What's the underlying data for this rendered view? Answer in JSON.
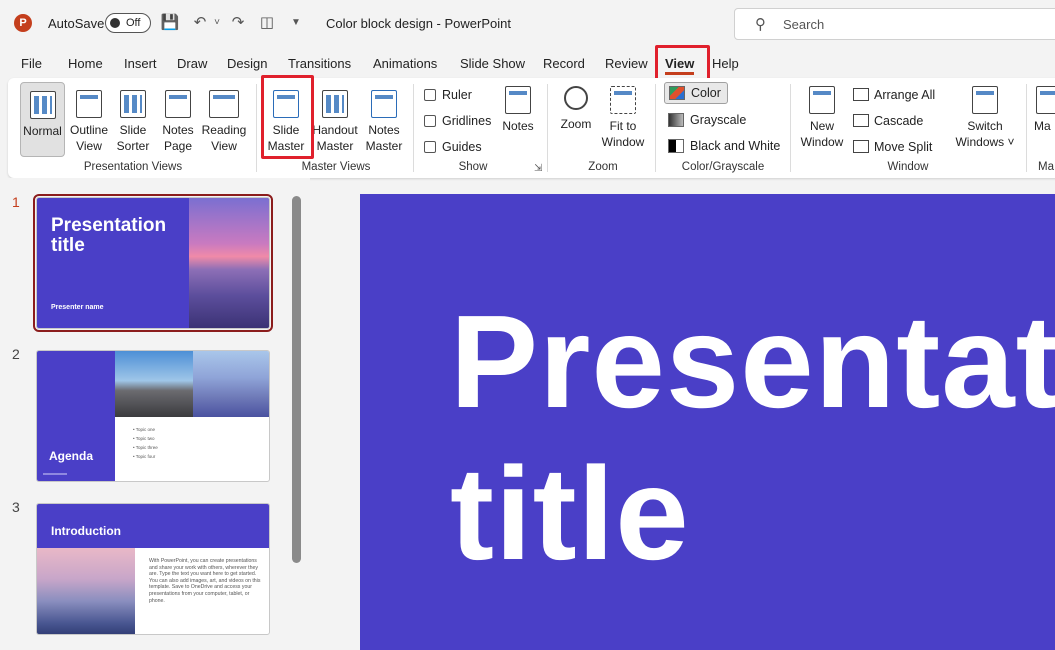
{
  "titlebar": {
    "logo": "P",
    "autosave_label": "AutoSave",
    "toggle_state": "Off",
    "doc_title": "Color block design  -  PowerPoint",
    "search_placeholder": "Search"
  },
  "menu": {
    "tabs": [
      "File",
      "Home",
      "Insert",
      "Draw",
      "Design",
      "Transitions",
      "Animations",
      "Slide Show",
      "Record",
      "Review",
      "View",
      "Help"
    ],
    "active": "View"
  },
  "ribbon": {
    "presentation_views": {
      "label": "Presentation Views",
      "normal": "Normal",
      "outline_1": "Outline",
      "outline_2": "View",
      "sorter_1": "Slide",
      "sorter_2": "Sorter",
      "notes_page_1": "Notes",
      "notes_page_2": "Page",
      "reading_1": "Reading",
      "reading_2": "View"
    },
    "master_views": {
      "label": "Master Views",
      "slide_master_1": "Slide",
      "slide_master_2": "Master",
      "handout_1": "Handout",
      "handout_2": "Master",
      "notes_master_1": "Notes",
      "notes_master_2": "Master"
    },
    "show": {
      "label": "Show",
      "ruler": "Ruler",
      "gridlines": "Gridlines",
      "guides": "Guides",
      "notes": "Notes"
    },
    "zoom": {
      "label": "Zoom",
      "zoom": "Zoom",
      "fit_1": "Fit to",
      "fit_2": "Window"
    },
    "color_grayscale": {
      "label": "Color/Grayscale",
      "color": "Color",
      "grayscale": "Grayscale",
      "bw": "Black and White"
    },
    "window": {
      "label": "Window",
      "new_1": "New",
      "new_2": "Window",
      "arrange_all": "Arrange All",
      "cascade": "Cascade",
      "move_split": "Move Split",
      "switch_1": "Switch",
      "switch_2": "Windows ˅"
    },
    "macros": {
      "label": "Ma",
      "btn": "Ma"
    }
  },
  "thumbnails": {
    "slide1": {
      "num": "1",
      "title": "Presentation title",
      "subtitle": "Presenter name"
    },
    "slide2": {
      "num": "2",
      "title": "Agenda",
      "items": [
        "Topic one",
        "Topic two",
        "Topic three",
        "Topic four"
      ]
    },
    "slide3": {
      "num": "3",
      "title": "Introduction",
      "body": "With PowerPoint, you can create presentations and share your work with others, wherever they are. Type the text you want here to get started. You can also add images, art, and videos on this template. Save to OneDrive and access your presentations from your computer, tablet, or phone."
    }
  },
  "main_slide": {
    "title_line1": "Presentat",
    "title_line2": "title"
  },
  "colors": {
    "slide_bg": "#4a3fc7",
    "highlight": "#e0202c",
    "accent": "#c43e1c"
  }
}
